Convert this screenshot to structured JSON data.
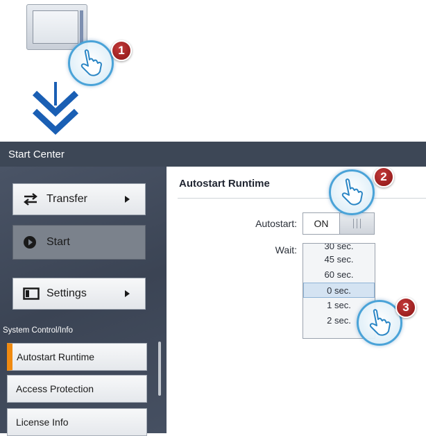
{
  "steps": [
    "1",
    "2",
    "3"
  ],
  "window": {
    "title": "Start Center"
  },
  "sidebar": {
    "transfer_label": "Transfer",
    "start_label": "Start",
    "settings_label": "Settings",
    "section_label": "System Control/Info",
    "items": [
      {
        "label": "Autostart Runtime",
        "active": true
      },
      {
        "label": "Access Protection",
        "active": false
      },
      {
        "label": "License Info",
        "active": false
      }
    ]
  },
  "main": {
    "title": "Autostart Runtime",
    "autostart_label": "Autostart:",
    "autostart_value": "ON",
    "wait_label": "Wait:",
    "wait_options": [
      "30 sec.",
      "45 sec.",
      "60 sec.",
      "0 sec.",
      "1 sec.",
      "2 sec."
    ],
    "wait_selected": "0 sec."
  },
  "colors": {
    "title_bar": "#3d4756",
    "sidebar_bg": "#3b4454",
    "active_accent": "#f08a10",
    "step_badge": "#a11c1c",
    "arrow_blue": "#1a5fb4",
    "selected_option": "#d4e3f2"
  }
}
